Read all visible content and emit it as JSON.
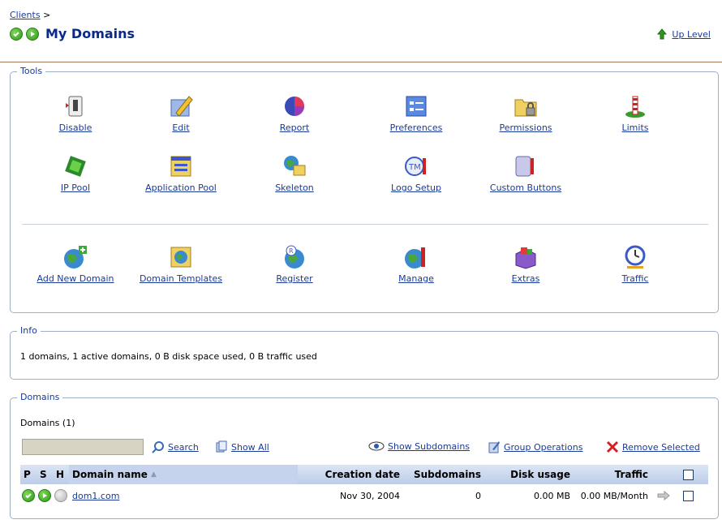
{
  "breadcrumb": {
    "clients_link": "Clients",
    "separator": ">"
  },
  "header": {
    "title": "My Domains",
    "up_level": "Up Level"
  },
  "tools": {
    "legend": "Tools",
    "row1": [
      {
        "label": "Disable",
        "icon": "switch-icon"
      },
      {
        "label": "Edit",
        "icon": "pencil-icon"
      },
      {
        "label": "Report",
        "icon": "pie-chart-icon"
      },
      {
        "label": "Preferences",
        "icon": "preferences-icon"
      },
      {
        "label": "Permissions",
        "icon": "lock-folder-icon"
      },
      {
        "label": "Limits",
        "icon": "limits-icon"
      }
    ],
    "row2": [
      {
        "label": "IP Pool",
        "icon": "ip-pool-icon"
      },
      {
        "label": "Application Pool",
        "icon": "application-pool-icon"
      },
      {
        "label": "Skeleton",
        "icon": "skeleton-icon"
      },
      {
        "label": "Logo Setup",
        "icon": "logo-setup-icon"
      },
      {
        "label": "Custom Buttons",
        "icon": "custom-buttons-icon"
      }
    ],
    "row3": [
      {
        "label": "Add New Domain",
        "icon": "add-domain-icon"
      },
      {
        "label": "Domain Templates",
        "icon": "domain-templates-icon"
      },
      {
        "label": "Register",
        "icon": "register-icon"
      },
      {
        "label": "Manage",
        "icon": "manage-icon"
      },
      {
        "label": "Extras",
        "icon": "extras-icon"
      },
      {
        "label": "Traffic",
        "icon": "traffic-icon"
      }
    ]
  },
  "info": {
    "legend": "Info",
    "text": "1 domains, 1 active domains, 0 B disk space used, 0 B traffic used"
  },
  "domains": {
    "legend": "Domains",
    "count": "Domains (1)",
    "search_value": "",
    "actions": {
      "search": "Search",
      "show_all": "Show All",
      "show_subdomains": "Show Subdomains",
      "group_operations": "Group Operations",
      "remove_selected": "Remove Selected"
    },
    "columns": {
      "p": "P",
      "s": "S",
      "h": "H",
      "name": "Domain name",
      "sort_indicator": "▲",
      "creation": "Creation date",
      "subdomains": "Subdomains",
      "disk": "Disk usage",
      "traffic": "Traffic"
    },
    "rows": [
      {
        "name": "dom1.com",
        "creation": "Nov 30, 2004",
        "subdomains": "0",
        "disk": "0.00 MB",
        "traffic": "0.00 MB/Month"
      }
    ]
  },
  "colors": {
    "link": "#1a3a9a",
    "title": "#0a2a8a",
    "header_bg": "#bccde8",
    "panel_border": "#9bb0c8",
    "ok_green": "#2c9a18"
  }
}
